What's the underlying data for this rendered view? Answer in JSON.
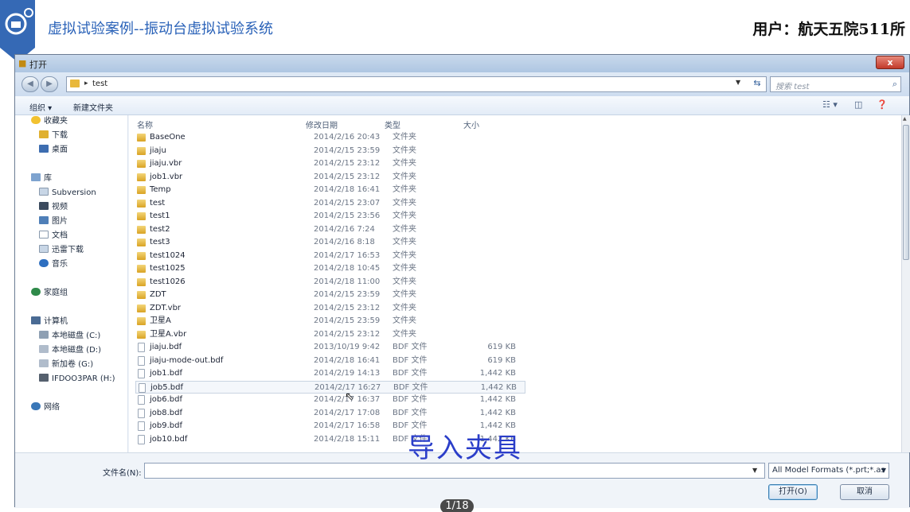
{
  "banner": {
    "title": "虚拟试验案例--振动台虚拟试验系统",
    "user": "用户：航天五院511所"
  },
  "dialog": {
    "title": "打开",
    "close_label": "x",
    "address": {
      "crumb": "test"
    },
    "search_placeholder": "搜索 test",
    "toolbar": {
      "organize": "组织 ▾",
      "new_folder": "新建文件夹"
    },
    "nav": [
      {
        "label": "收藏夹",
        "icon": "star-icon"
      },
      {
        "label": "下载",
        "icon": "download-folder-icon"
      },
      {
        "label": "桌面",
        "icon": "desktop-icon"
      },
      {
        "label": "库",
        "icon": "library-icon"
      },
      {
        "label": "Subversion",
        "icon": "library-folder-icon"
      },
      {
        "label": "视频",
        "icon": "video-icon"
      },
      {
        "label": "图片",
        "icon": "picture-icon"
      },
      {
        "label": "文档",
        "icon": "document-icon"
      },
      {
        "label": "迅雷下载",
        "icon": "library-folder-icon"
      },
      {
        "label": "音乐",
        "icon": "music-icon"
      },
      {
        "label": "家庭组",
        "icon": "homegroup-icon"
      },
      {
        "label": "计算机",
        "icon": "computer-icon"
      },
      {
        "label": "本地磁盘 (C:)",
        "icon": "drive-icon"
      },
      {
        "label": "本地磁盘 (D:)",
        "icon": "drive-icon"
      },
      {
        "label": "新加卷 (G:)",
        "icon": "drive-icon"
      },
      {
        "label": "IFDOO3PAR (H:)",
        "icon": "drive-icon"
      },
      {
        "label": "网络",
        "icon": "network-icon"
      }
    ],
    "columns": {
      "name": "名称",
      "date": "修改日期",
      "type": "类型",
      "size": "大小"
    },
    "files": [
      {
        "name": "BaseOne",
        "date": "2014/2/16 20:43",
        "type": "文件夹",
        "size": "",
        "kind": "folder"
      },
      {
        "name": "jiaju",
        "date": "2014/2/15 23:59",
        "type": "文件夹",
        "size": "",
        "kind": "folder"
      },
      {
        "name": "jiaju.vbr",
        "date": "2014/2/15 23:12",
        "type": "文件夹",
        "size": "",
        "kind": "folder"
      },
      {
        "name": "job1.vbr",
        "date": "2014/2/15 23:12",
        "type": "文件夹",
        "size": "",
        "kind": "folder"
      },
      {
        "name": "Temp",
        "date": "2014/2/18 16:41",
        "type": "文件夹",
        "size": "",
        "kind": "folder"
      },
      {
        "name": "test",
        "date": "2014/2/15 23:07",
        "type": "文件夹",
        "size": "",
        "kind": "folder"
      },
      {
        "name": "test1",
        "date": "2014/2/15 23:56",
        "type": "文件夹",
        "size": "",
        "kind": "folder"
      },
      {
        "name": "test2",
        "date": "2014/2/16 7:24",
        "type": "文件夹",
        "size": "",
        "kind": "folder"
      },
      {
        "name": "test3",
        "date": "2014/2/16 8:18",
        "type": "文件夹",
        "size": "",
        "kind": "folder"
      },
      {
        "name": "test1024",
        "date": "2014/2/17 16:53",
        "type": "文件夹",
        "size": "",
        "kind": "folder"
      },
      {
        "name": "test1025",
        "date": "2014/2/18 10:45",
        "type": "文件夹",
        "size": "",
        "kind": "folder"
      },
      {
        "name": "test1026",
        "date": "2014/2/18 11:00",
        "type": "文件夹",
        "size": "",
        "kind": "folder"
      },
      {
        "name": "ZDT",
        "date": "2014/2/15 23:59",
        "type": "文件夹",
        "size": "",
        "kind": "folder"
      },
      {
        "name": "ZDT.vbr",
        "date": "2014/2/15 23:12",
        "type": "文件夹",
        "size": "",
        "kind": "folder"
      },
      {
        "name": "卫星A",
        "date": "2014/2/15 23:59",
        "type": "文件夹",
        "size": "",
        "kind": "folder"
      },
      {
        "name": "卫星A.vbr",
        "date": "2014/2/15 23:12",
        "type": "文件夹",
        "size": "",
        "kind": "folder"
      },
      {
        "name": "jiaju.bdf",
        "date": "2013/10/19 9:42",
        "type": "BDF 文件",
        "size": "619 KB",
        "kind": "file"
      },
      {
        "name": "jiaju-mode-out.bdf",
        "date": "2014/2/18 16:41",
        "type": "BDF 文件",
        "size": "619 KB",
        "kind": "file"
      },
      {
        "name": "job1.bdf",
        "date": "2014/2/19 14:13",
        "type": "BDF 文件",
        "size": "1,442 KB",
        "kind": "file"
      },
      {
        "name": "job5.bdf",
        "date": "2014/2/17 16:27",
        "type": "BDF 文件",
        "size": "1,442 KB",
        "kind": "file"
      },
      {
        "name": "job6.bdf",
        "date": "2014/2/17 16:37",
        "type": "BDF 文件",
        "size": "1,442 KB",
        "kind": "file"
      },
      {
        "name": "job8.bdf",
        "date": "2014/2/17 17:08",
        "type": "BDF 文件",
        "size": "1,442 KB",
        "kind": "file"
      },
      {
        "name": "job9.bdf",
        "date": "2014/2/17 16:58",
        "type": "BDF 文件",
        "size": "1,442 KB",
        "kind": "file"
      },
      {
        "name": "job10.bdf",
        "date": "2014/2/18 15:11",
        "type": "BDF 文件",
        "size": "1,442 KB",
        "kind": "file"
      }
    ],
    "filename_label": "文件名(N):",
    "filename_value": "",
    "filter": "All Model Formats (*.prt;*.as",
    "open_button": "打开(O)",
    "cancel_button": "取消"
  },
  "overlay_caption": "导入夹具",
  "page_indicator": "1/18",
  "colors": {
    "banner_title": "#2a62b8",
    "caption": "#2b3ec9",
    "selection": "#f4f7fb"
  }
}
